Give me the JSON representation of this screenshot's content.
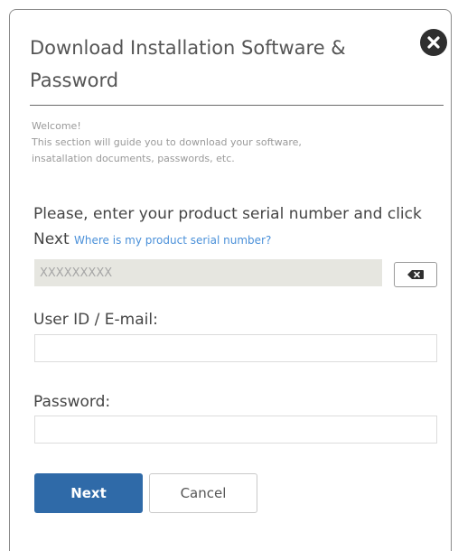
{
  "dialog": {
    "title": "Download Installation Software & Password",
    "close_icon": "close-circle-icon"
  },
  "intro": {
    "line1": "Welcome!",
    "line2": "This section will guide you to download your software,",
    "line3": "insatallation documents, passwords, etc."
  },
  "serial": {
    "prompt": "Please, enter your product serial number and click Next",
    "help_link": "Where is my product serial number?",
    "placeholder": "XXXXXXXXX",
    "clear_icon": "backspace-icon"
  },
  "user": {
    "label": "User ID / E-mail:",
    "value": ""
  },
  "password": {
    "label": "Password:",
    "value": ""
  },
  "actions": {
    "next_label": "Next",
    "cancel_label": "Cancel"
  },
  "colors": {
    "primary": "#2f6aa8",
    "link": "#4a90d9",
    "serial_bg": "#e6e6e0"
  }
}
